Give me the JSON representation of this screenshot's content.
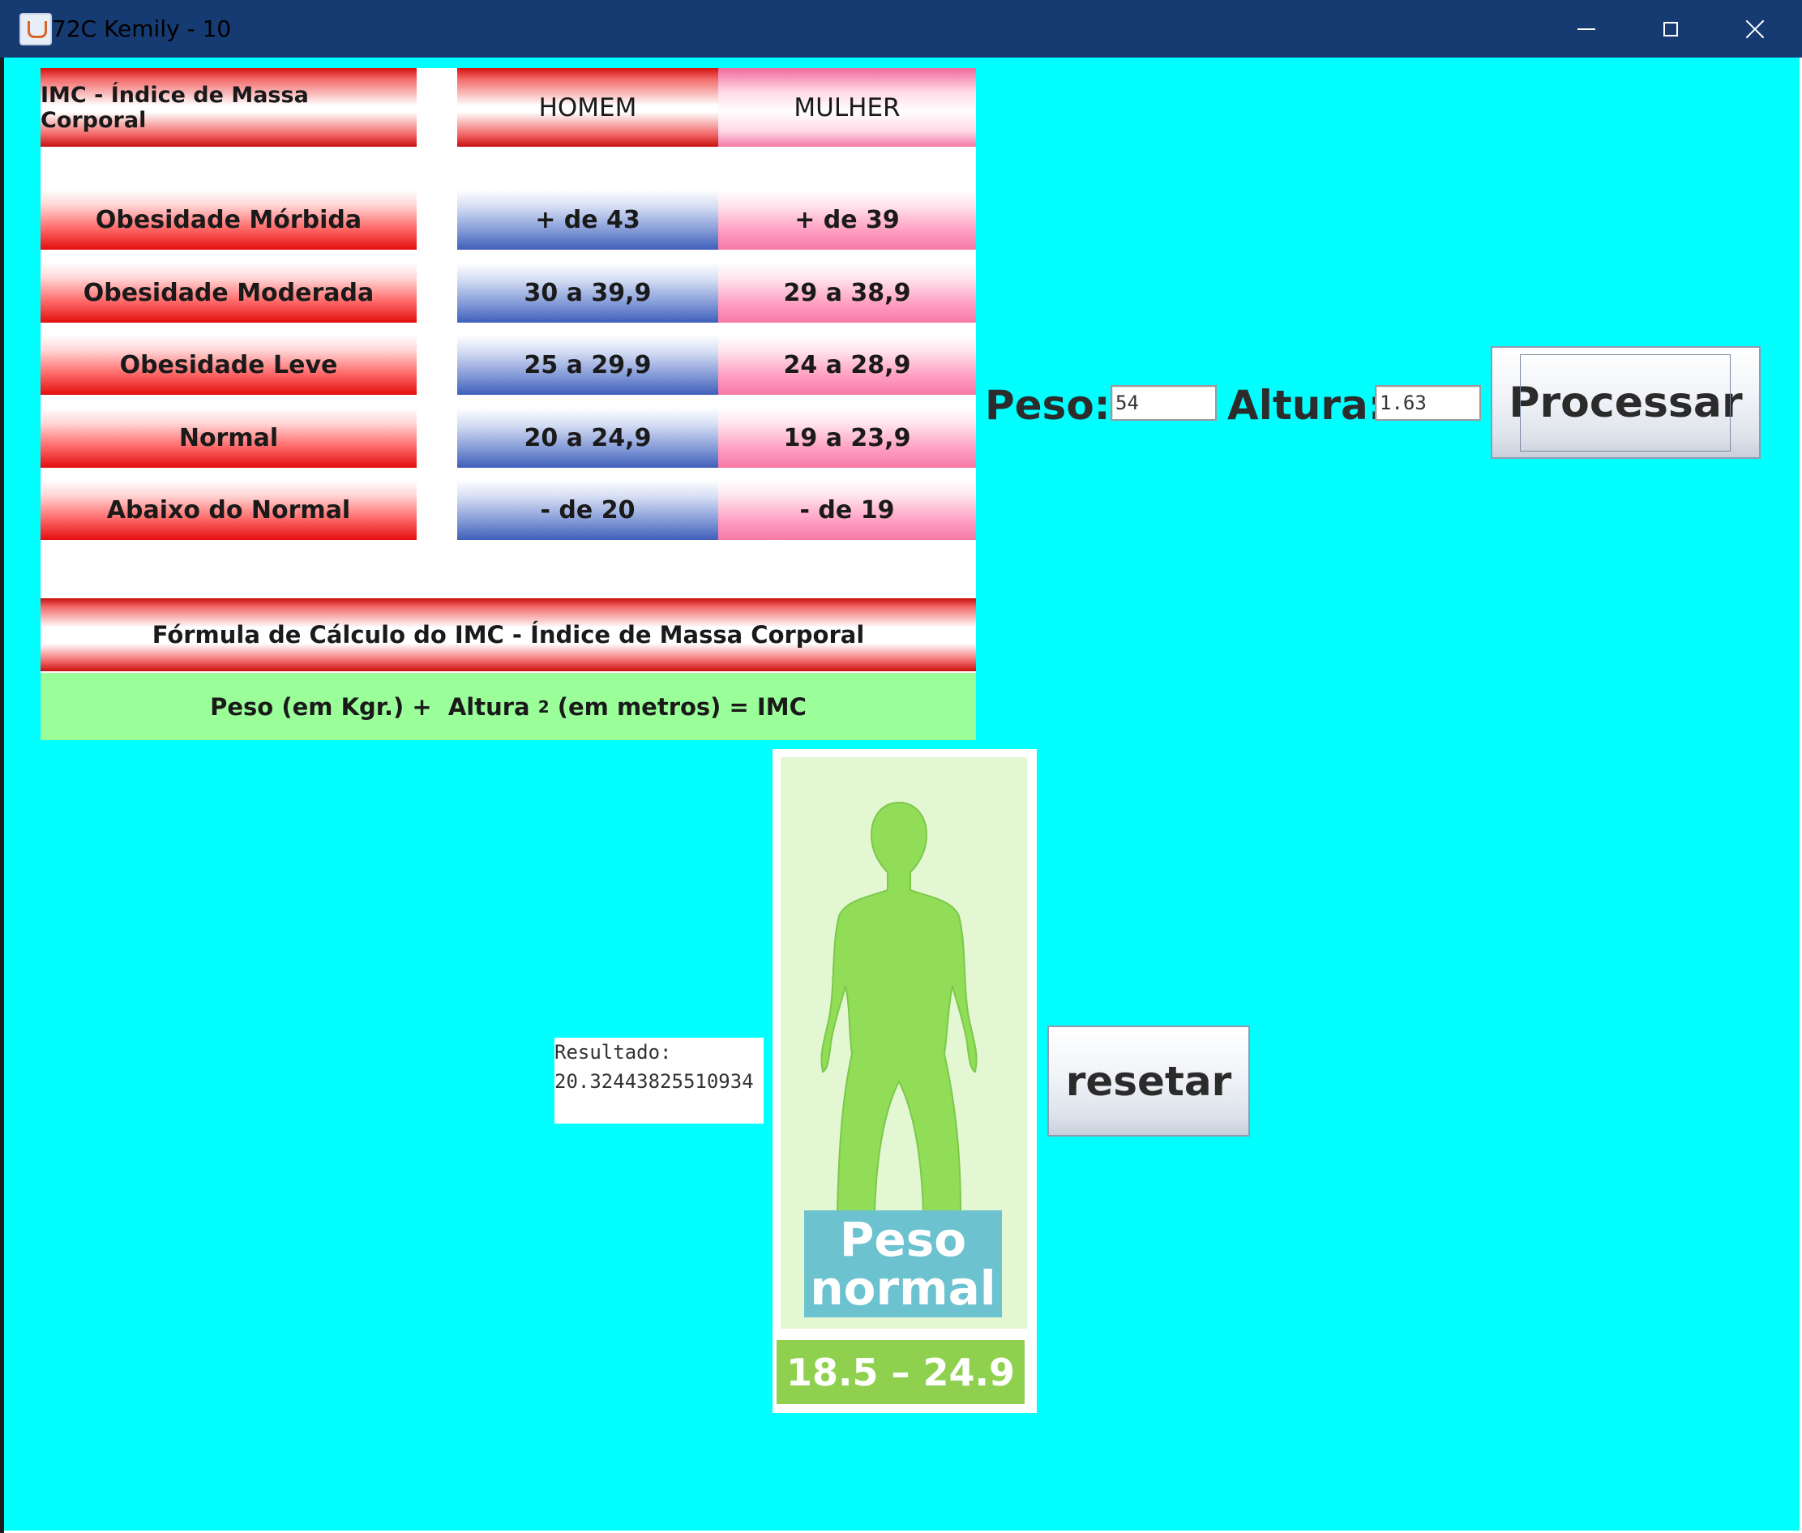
{
  "window": {
    "title": "72C Kemily - 10",
    "icons": {
      "app": "java-cup-icon",
      "minimize": "minimize-icon",
      "maximize": "maximize-icon",
      "close": "close-icon"
    }
  },
  "colors": {
    "background": "#00ffff",
    "titlebar": "#163a72"
  },
  "imc_table": {
    "header": {
      "title": "IMC - Índice de Massa Corporal",
      "homem": "HOMEM",
      "mulher": "MULHER"
    },
    "rows": [
      {
        "category": "Obesidade Mórbida",
        "homem": "+ de 43",
        "mulher": "+ de 39"
      },
      {
        "category": "Obesidade Moderada",
        "homem": "30 a 39,9",
        "mulher": "29 a 38,9"
      },
      {
        "category": "Obesidade Leve",
        "homem": "25 a 29,9",
        "mulher": "24 a 28,9"
      },
      {
        "category": "Normal",
        "homem": "20 a 24,9",
        "mulher": "19 a 23,9"
      },
      {
        "category": "Abaixo do Normal",
        "homem": "- de 20",
        "mulher": "- de 19"
      }
    ],
    "formula_title": "Fórmula de Cálculo do IMC - Índice de Massa Corporal",
    "formula": {
      "part1": "Peso (em Kgr.) +  Altura ",
      "exponent": "2",
      "part2": " (em metros) = IMC"
    }
  },
  "form": {
    "peso_label": "Peso:",
    "peso_value": "54",
    "altura_label": "Altura:",
    "altura_value": "1.63",
    "processar_label": "Processar",
    "resetar_label": "resetar"
  },
  "result": {
    "label": "Resultado:",
    "value": "20.32443825510934"
  },
  "figure": {
    "icon": "person-silhouette-icon",
    "badge_line1": "Peso",
    "badge_line2": "normal",
    "range": "18.5 – 24.9"
  }
}
